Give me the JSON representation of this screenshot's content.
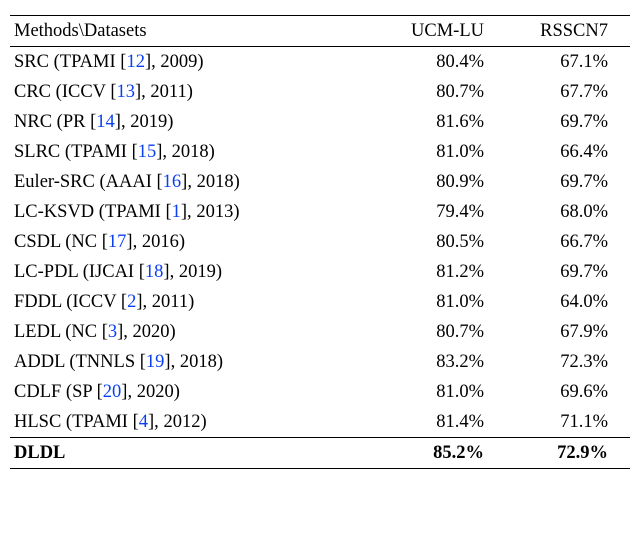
{
  "header": {
    "methods": "Methods\\Datasets",
    "col1": "UCM-LU",
    "col2": "RSSCN7"
  },
  "rows": [
    {
      "name": "SRC",
      "venue": "TPAMI",
      "ref": "12",
      "year": "2009",
      "v1": "80.4%",
      "v2": "67.1%"
    },
    {
      "name": "CRC",
      "venue": "ICCV",
      "ref": "13",
      "year": "2011",
      "v1": "80.7%",
      "v2": "67.7%"
    },
    {
      "name": "NRC",
      "venue": "PR",
      "ref": "14",
      "year": "2019",
      "v1": "81.6%",
      "v2": "69.7%"
    },
    {
      "name": "SLRC",
      "venue": "TPAMI",
      "ref": "15",
      "year": "2018",
      "v1": "81.0%",
      "v2": "66.4%"
    },
    {
      "name": "Euler-SRC",
      "venue": "AAAI",
      "ref": "16",
      "year": "2018",
      "v1": "80.9%",
      "v2": "69.7%"
    },
    {
      "name": "LC-KSVD",
      "venue": "TPAMI",
      "ref": "1",
      "year": "2013",
      "v1": "79.4%",
      "v2": "68.0%"
    },
    {
      "name": "CSDL",
      "venue": "NC",
      "ref": "17",
      "year": "2016",
      "v1": "80.5%",
      "v2": "66.7%"
    },
    {
      "name": "LC-PDL",
      "venue": "IJCAI",
      "ref": "18",
      "year": "2019",
      "v1": "81.2%",
      "v2": "69.7%"
    },
    {
      "name": "FDDL",
      "venue": "ICCV",
      "ref": "2",
      "year": "2011",
      "v1": "81.0%",
      "v2": "64.0%"
    },
    {
      "name": "LEDL",
      "venue": "NC",
      "ref": "3",
      "year": "2020",
      "v1": "80.7%",
      "v2": "67.9%"
    },
    {
      "name": "ADDL",
      "venue": "TNNLS",
      "ref": "19",
      "year": "2018",
      "v1": "83.2%",
      "v2": "72.3%"
    },
    {
      "name": "CDLF",
      "venue": "SP",
      "ref": "20",
      "year": "2020",
      "v1": "81.0%",
      "v2": "69.6%"
    },
    {
      "name": "HLSC",
      "venue": "TPAMI",
      "ref": "4",
      "year": "2012",
      "v1": "81.4%",
      "v2": "71.1%"
    }
  ],
  "highlight": {
    "name": "DLDL",
    "v1": "85.2%",
    "v2": "72.9%"
  }
}
